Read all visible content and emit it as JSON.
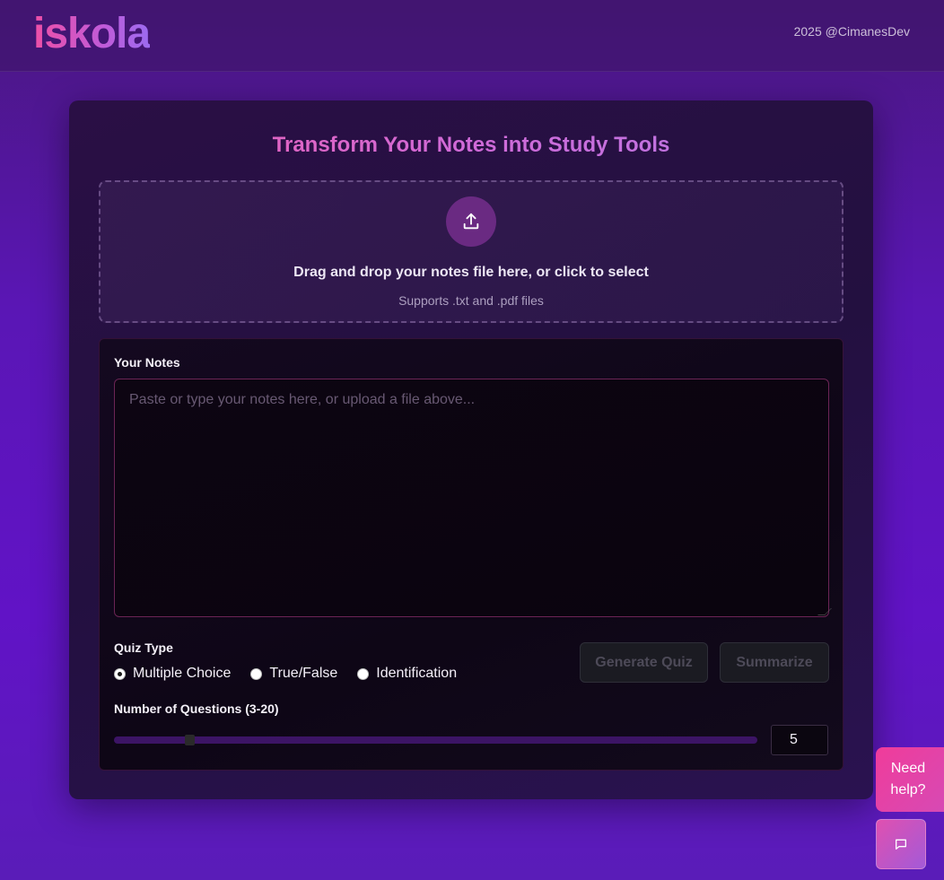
{
  "header": {
    "logo": "iskola",
    "copyright": "2025 @CimanesDev"
  },
  "card": {
    "title": "Transform Your Notes into Study Tools",
    "dropzone": {
      "icon": "upload-icon",
      "main_text": "Drag and drop your notes file here, or click to select",
      "sub_text": "Supports .txt and .pdf files"
    },
    "notes": {
      "label": "Your Notes",
      "value": "",
      "placeholder": "Paste or type your notes here, or upload a file above..."
    },
    "quiz_type": {
      "label": "Quiz Type",
      "options": [
        {
          "label": "Multiple Choice",
          "checked": true
        },
        {
          "label": "True/False",
          "checked": false
        },
        {
          "label": "Identification",
          "checked": false
        }
      ]
    },
    "buttons": {
      "generate_label": "Generate Quiz",
      "summarize_label": "Summarize"
    },
    "questions": {
      "label": "Number of Questions (3-20)",
      "min": 3,
      "max": 20,
      "value": "5"
    }
  },
  "help": {
    "label": "Need help?",
    "chat_icon": "chat-bubble-icon"
  },
  "colors": {
    "accent_pink": "#ee4fa6",
    "accent_purple": "#9c6bf0",
    "background": "#5a16b5"
  }
}
